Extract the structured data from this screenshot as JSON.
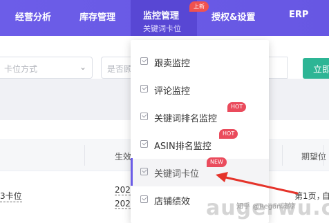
{
  "topnav": {
    "items": [
      "经营分析",
      "库存管理",
      "监控管理",
      "授权&设置",
      "ERP"
    ],
    "active_label": "监控管理",
    "active_sub": "关键词卡位",
    "active_badge": "上新"
  },
  "filters": {
    "select1_placeholder": "卡位方式",
    "select2_placeholder": "是否顾",
    "button_label": "立即"
  },
  "table": {
    "headers": [
      "生效",
      "期望位"
    ],
    "row": {
      "name": "3卡位",
      "date1": "202",
      "date2": "202",
      "rank": "第1页，",
      "extra": "自"
    }
  },
  "dropdown": {
    "items": [
      {
        "label": "跟卖监控",
        "badge": ""
      },
      {
        "label": "评论监控",
        "badge": ""
      },
      {
        "label": "关键词排名监控",
        "badge": "HOT"
      },
      {
        "label": "ASIN排名监控",
        "badge": "HOT"
      },
      {
        "label": "关键词卡位",
        "badge": "NEW"
      },
      {
        "label": "店铺绩效",
        "badge": ""
      }
    ]
  },
  "overlay": {
    "watermark": "augerwu.com",
    "zhihu": "知乎 @Regan骑鲸"
  },
  "colors": {
    "nav_bg": "#6b5ce7",
    "nav_active_bg": "#5847d4",
    "primary_button": "#2db595",
    "badge_red": "#ea4b5c",
    "arrow_red": "#e5332a"
  }
}
